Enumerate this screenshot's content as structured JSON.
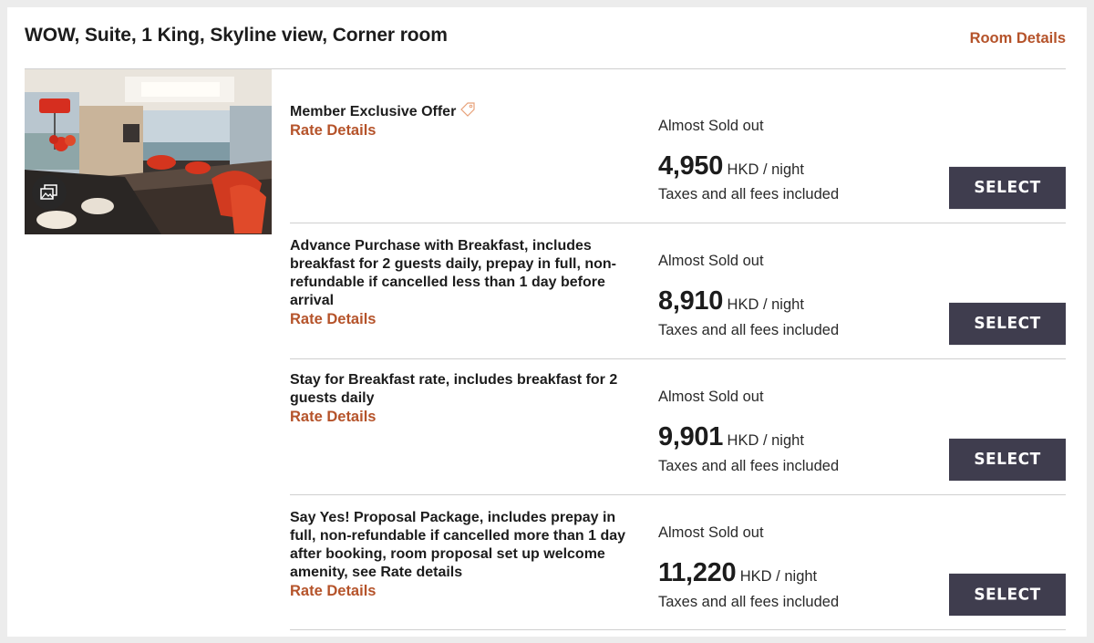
{
  "room": {
    "title": "WOW, Suite, 1 King, Skyline view, Corner room",
    "details_link": "Room Details"
  },
  "photo": {
    "icon": "gallery-icon"
  },
  "rates": [
    {
      "name": "Member Exclusive Offer",
      "has_tag_icon": true,
      "link": "Rate Details",
      "availability": "Almost Sold out",
      "price": "4,950",
      "unit": "HKD / night",
      "taxes": "Taxes and all fees included",
      "button": "SELECT"
    },
    {
      "name": "Advance Purchase with Breakfast, includes breakfast for 2 guests daily, prepay in full, non-refundable if cancelled less than 1 day before arrival",
      "link": "Rate Details",
      "availability": "Almost Sold out",
      "price": "8,910",
      "unit": "HKD / night",
      "taxes": "Taxes and all fees included",
      "button": "SELECT"
    },
    {
      "name": "Stay for Breakfast rate, includes breakfast for 2 guests daily",
      "link": "Rate Details",
      "availability": "Almost Sold out",
      "price": "9,901",
      "unit": "HKD / night",
      "taxes": "Taxes and all fees included",
      "button": "SELECT"
    },
    {
      "name": "Say Yes! Proposal Package, includes prepay in full, non-refundable if cancelled more than 1 day after booking, room proposal set up welcome amenity, see Rate details",
      "link": "Rate Details",
      "availability": "Almost Sold out",
      "price": "11,220",
      "unit": "HKD / night",
      "taxes": "Taxes and all fees included",
      "button": "SELECT"
    }
  ],
  "colors": {
    "accent": "#b5532a",
    "button": "#3f3d4e",
    "divider": "#cfcfcf"
  }
}
